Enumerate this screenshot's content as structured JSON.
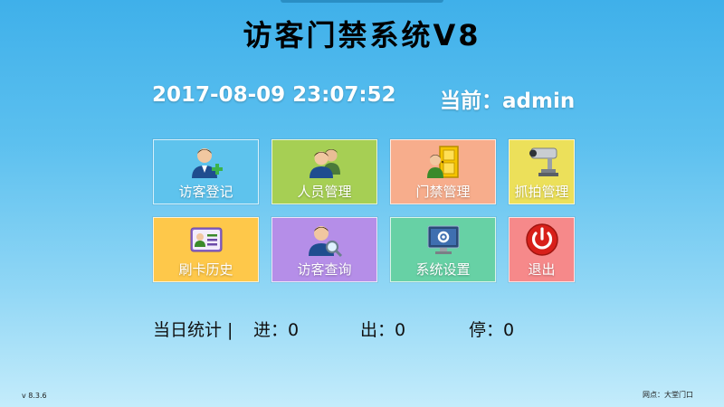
{
  "header": {
    "title": "访客门禁系统V8"
  },
  "status": {
    "datetime": "2017-08-09 23:07:52",
    "current_user": "当前：admin"
  },
  "menu": {
    "tiles": [
      {
        "label": "访客登记",
        "color": "#5ec3ed",
        "icon": "visitor-register-icon"
      },
      {
        "label": "人员管理",
        "color": "#a6cf54",
        "icon": "people-icon"
      },
      {
        "label": "门禁管理",
        "color": "#f7ad8c",
        "icon": "door-icon"
      },
      {
        "label": "抓拍管理",
        "color": "#ece05a",
        "icon": "camera-icon"
      },
      {
        "label": "刷卡历史",
        "color": "#fec84a",
        "icon": "id-card-icon"
      },
      {
        "label": "访客查询",
        "color": "#b58ee8",
        "icon": "search-user-icon"
      },
      {
        "label": "系统设置",
        "color": "#67d1a5",
        "icon": "settings-icon"
      },
      {
        "label": "退出",
        "color": "#f6898a",
        "icon": "power-icon"
      }
    ]
  },
  "stats": {
    "heading": "当日统计 |",
    "in_label": "进：0",
    "out_label": "出：0",
    "stay_label": "停：0"
  },
  "footer": {
    "version": "v 8.3.6",
    "site": "网点：大堂门口"
  }
}
